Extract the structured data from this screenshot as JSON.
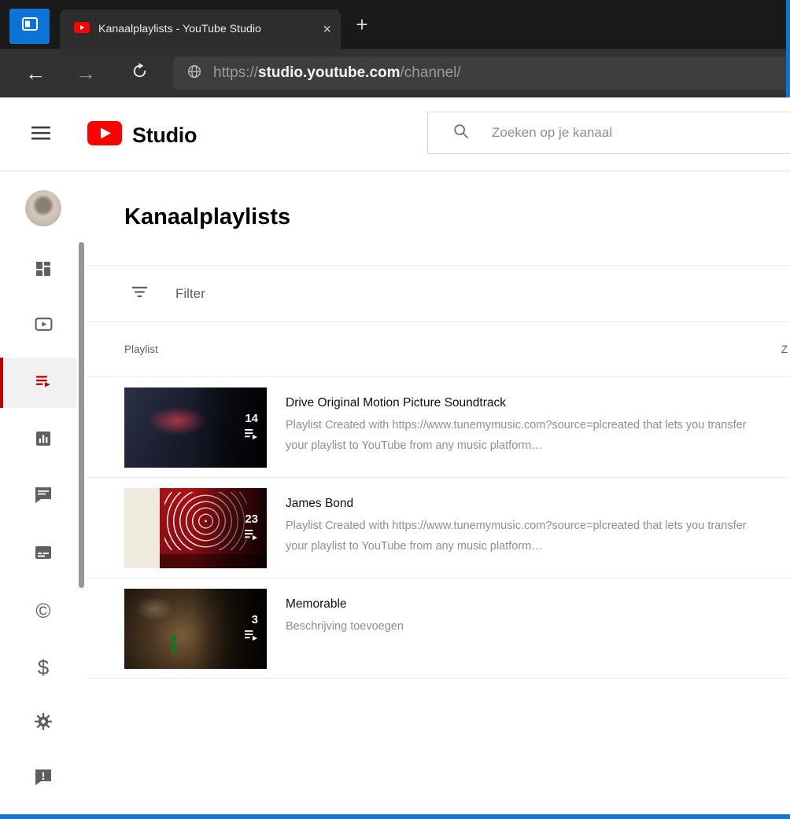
{
  "browser": {
    "tab_title": "Kanaalplaylists - YouTube Studio",
    "url_prefix": "https://",
    "url_domain": "studio.youtube.com",
    "url_path": "/channel/"
  },
  "glyphs": {
    "close": "×",
    "plus": "+",
    "back": "←",
    "forward": "→",
    "copyright": "©",
    "monetization": "$"
  },
  "studio_header": {
    "brand": "Studio",
    "search_placeholder": "Zoeken op je kanaal"
  },
  "main": {
    "title": "Kanaalplaylists",
    "filter_label": "Filter",
    "table_header": {
      "playlist": "Playlist",
      "visibility_clipped": "Z"
    },
    "rows": [
      {
        "count": "14",
        "title": "Drive Original Motion Picture Soundtrack",
        "description": "Playlist Created with https://www.tunemymusic.com?source=plcreated that lets you transfer your playlist to YouTube from any music platform…"
      },
      {
        "count": "23",
        "title": "James Bond",
        "description": "Playlist Created with https://www.tunemymusic.com?source=plcreated that lets you transfer your playlist to YouTube from any music platform…"
      },
      {
        "count": "3",
        "title": "Memorable",
        "description": "Beschrijving toevoegen"
      }
    ]
  },
  "colors": {
    "accent_blue": "#0b74d4",
    "youtube_red": "#ff0000",
    "active_item_red": "#c00000"
  }
}
